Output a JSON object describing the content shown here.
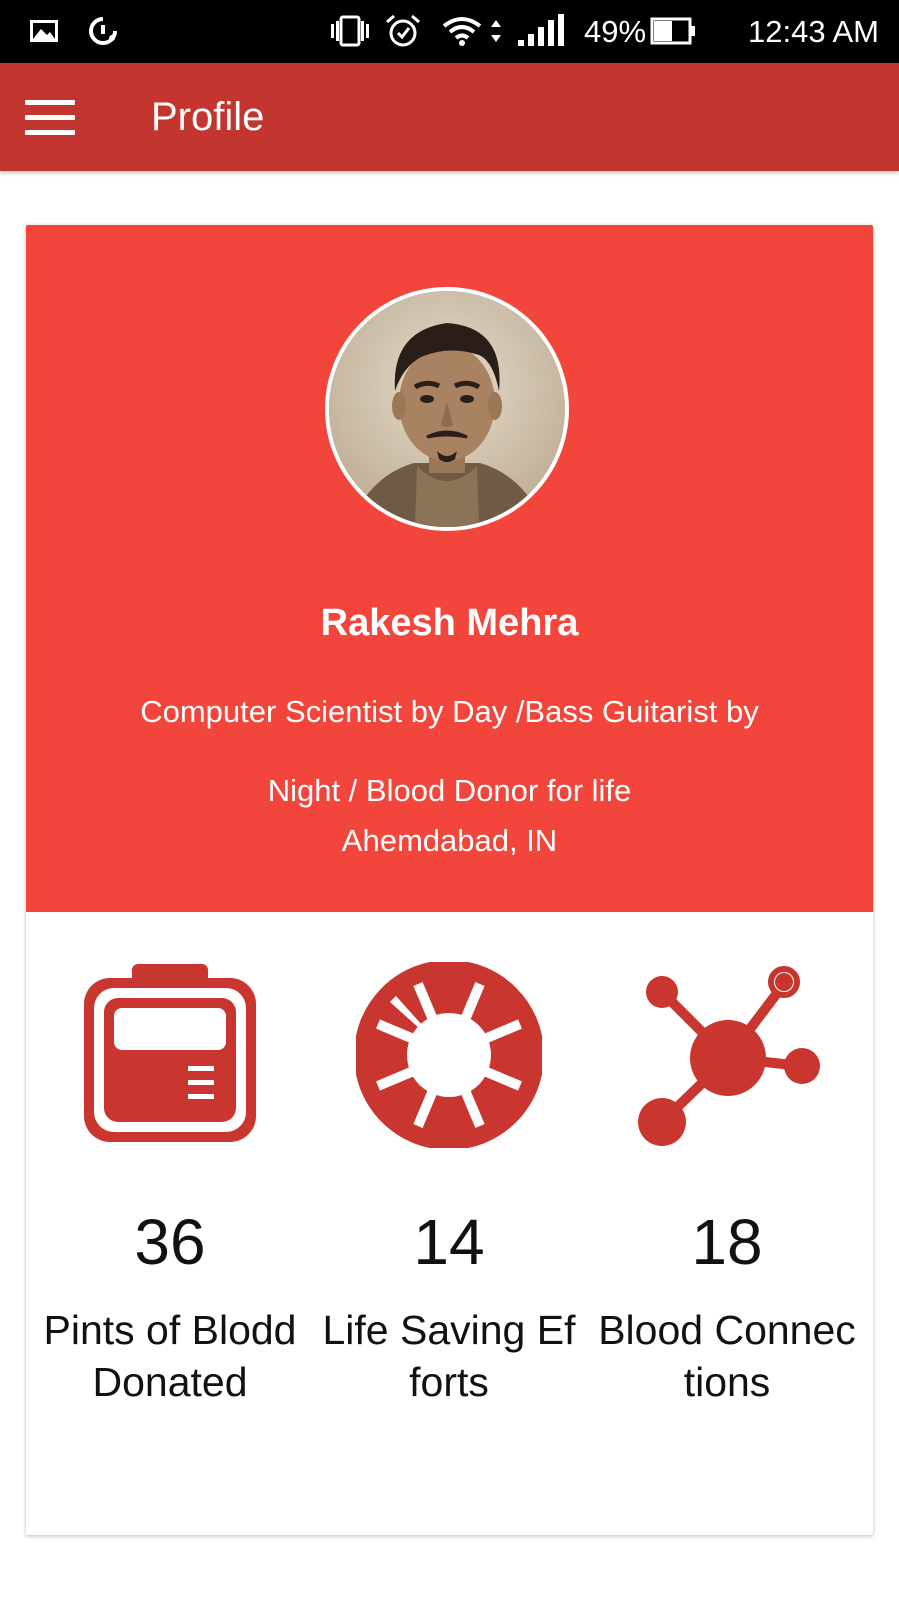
{
  "status_bar": {
    "battery_percent": "49%",
    "time": "12:43 AM",
    "icons": [
      "picture-icon",
      "data-saver-icon",
      "vibrate-icon",
      "alarm-icon",
      "wifi-icon",
      "signal-icon",
      "battery-icon"
    ]
  },
  "app_bar": {
    "title": "Profile",
    "menu_icon": "hamburger-menu-icon"
  },
  "profile": {
    "name": "Rakesh Mehra",
    "bio": "Computer Scientist by Day /Bass Guitarist by Night / Blood Donor for life",
    "location": "Ahemdabad, IN"
  },
  "stats": [
    {
      "icon": "blood-bag-icon",
      "value": "36",
      "label": "Pints of Blodd Donated"
    },
    {
      "icon": "life-ring-icon",
      "value": "14",
      "label": "Life Saving Efforts"
    },
    {
      "icon": "network-connections-icon",
      "value": "18",
      "label": "Blood Connections"
    }
  ],
  "colors": {
    "status_bar": "#000000",
    "app_bar": "#c3352f",
    "header": "#f2453b",
    "icon": "#c9352f",
    "text_dark": "#111111"
  }
}
